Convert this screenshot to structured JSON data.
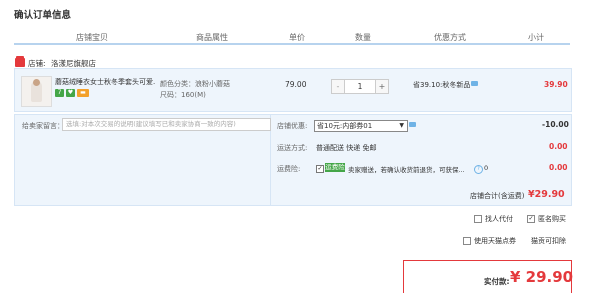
{
  "page_title": "确认订单信息",
  "columns": [
    "店铺宝贝",
    "商品属性",
    "单价",
    "数量",
    "优惠方式",
    "小计"
  ],
  "shop": {
    "label": "店铺:",
    "name": "洛漾尼旗舰店"
  },
  "item": {
    "name": "蘑菇绒睡衣女士秋冬季套头可爱...",
    "badges": [
      "7",
      "♥",
      "▬"
    ],
    "badge_colors": [
      "#44a648",
      "#44a648",
      "#f3a12b"
    ],
    "attr_color": "颜色分类：浪粉小蘑菇",
    "attr_size": "尺码：160(M)",
    "price": "79.00",
    "qty_minus": "-",
    "qty": "1",
    "qty_plus": "+",
    "promo": "省39.10:秋冬新品",
    "subtotal": "39.90"
  },
  "message": {
    "label": "给卖家留言：",
    "placeholder": "选填:对本次交易的说明(建议填写已和卖家协商一致的内容)"
  },
  "discount": {
    "label": "店铺优惠:",
    "selected": "省10元:内部券01",
    "arrow": "▼",
    "value": "-10.00"
  },
  "shipping": {
    "label": "运送方式:",
    "method": "普通配送 快递 免邮",
    "value": "0.00"
  },
  "insurance": {
    "label": "运费险:",
    "check": "✓",
    "tag": "运费险",
    "text": "卖家赠送，若确认收货前退货，可获保...",
    "q": "?",
    "count": "0",
    "value": "0.00"
  },
  "store_total": {
    "label": "店铺合计(含运费)",
    "value": "¥29.90"
  },
  "options": {
    "anonymous_other": "找人代付",
    "anonymous_buy": "匿名购买",
    "anonymous_buy_check": "✓",
    "tmall_points": "使用天猫点券",
    "points_info": "猫贡可扣除"
  },
  "payment": {
    "label": "实付款:",
    "value": "¥ 29.90"
  },
  "colors": {
    "accent": "#e4393c",
    "header_line": "#b7d3ee",
    "panel_bg": "#eef5fc"
  }
}
